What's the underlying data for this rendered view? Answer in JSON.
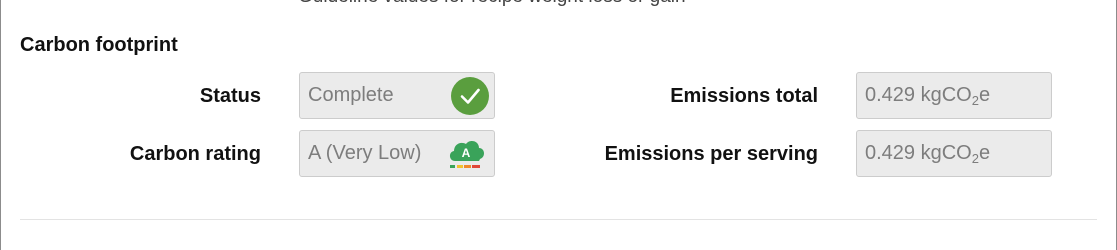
{
  "header": {
    "caption": "Guideline values for recipe weight loss or gain"
  },
  "carbon_footprint": {
    "title": "Carbon footprint",
    "status_label": "Status",
    "status_value": "Complete",
    "status_icon": "check-circle-icon",
    "status_color": "#5a9e3e",
    "rating_label": "Carbon rating",
    "rating_value": "A (Very Low)",
    "rating_icon": "carbon-rating-cloud-icon",
    "rating_badge_letter": "A",
    "rating_color": "#3aa35a",
    "emissions_total_label": "Emissions total",
    "emissions_total_number": "0.429 kgCO",
    "emissions_total_subscript": "2",
    "emissions_total_suffix": "e",
    "emissions_per_serving_label": "Emissions per serving",
    "emissions_per_serving_number": "0.429 kgCO",
    "emissions_per_serving_subscript": "2",
    "emissions_per_serving_suffix": "e"
  }
}
